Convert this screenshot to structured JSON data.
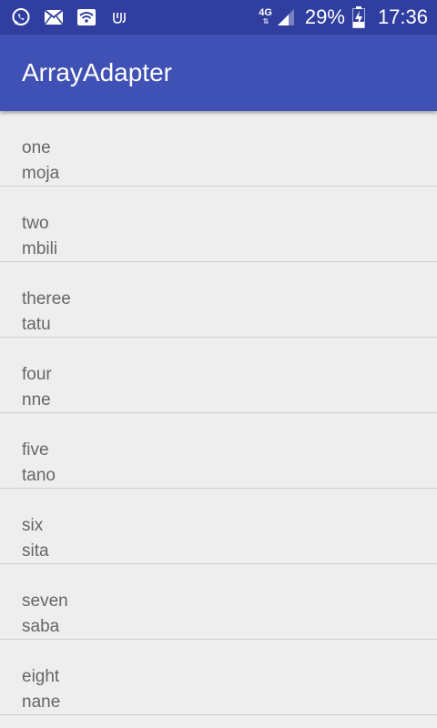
{
  "status_bar": {
    "left_icons": [
      "whatsapp-icon",
      "mail-icon",
      "wifi-icon",
      "udacity-icon"
    ],
    "network_type": "4G",
    "battery_percent": "29%",
    "time": "17:36"
  },
  "app_bar": {
    "title": "ArrayAdapter",
    "color": "#3f51b5",
    "status_color": "#303f9f"
  },
  "list": {
    "items": [
      {
        "primary": "one",
        "secondary": "moja"
      },
      {
        "primary": "two",
        "secondary": "mbili"
      },
      {
        "primary": "theree",
        "secondary": "tatu"
      },
      {
        "primary": "four",
        "secondary": "nne"
      },
      {
        "primary": "five",
        "secondary": "tano"
      },
      {
        "primary": "six",
        "secondary": "sita"
      },
      {
        "primary": "seven",
        "secondary": "saba"
      },
      {
        "primary": "eight",
        "secondary": "nane"
      }
    ]
  }
}
